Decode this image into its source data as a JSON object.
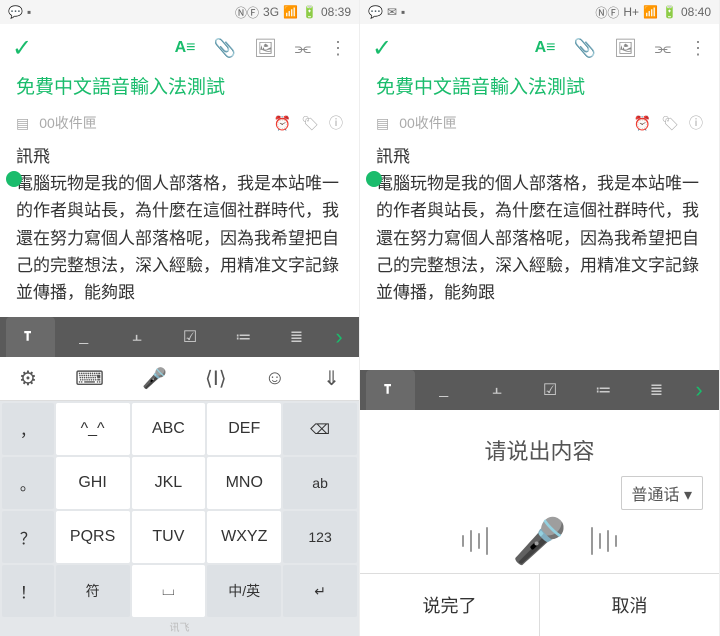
{
  "left": {
    "status": {
      "time": "08:39",
      "net": "3G"
    },
    "title": "免費中文語音輸入法測試",
    "inbox": "00收件匣",
    "author": "訊飛",
    "body": "電腦玩物是我的個人部落格，我是本站唯一的作者與站長，為什麼在這個社群時代，我還在努力寫個人部落格呢，因為我希望把自己的完整想法，深入經驗，用精准文字記錄並傳播，能夠跟",
    "keys": {
      "r1": [
        "，",
        "^_^",
        "ABC",
        "DEF",
        "⌫"
      ],
      "r2": [
        "。",
        "GHI",
        "JKL",
        "MNO",
        "ab"
      ],
      "r3": [
        "？",
        "PQRS",
        "TUV",
        "WXYZ",
        "123"
      ],
      "r4": [
        "！",
        "符",
        "⌴",
        "中/英",
        "↵"
      ]
    },
    "brand": "讯飞"
  },
  "right": {
    "status": {
      "time": "08:40",
      "net": "H+"
    },
    "title": "免費中文語音輸入法測試",
    "inbox": "00收件匣",
    "author": "訊飛",
    "body": "電腦玩物是我的個人部落格，我是本站唯一的作者與站長，為什麼在這個社群時代，我還在努力寫個人部落格呢，因為我希望把自己的完整想法，深入經驗，用精准文字記錄並傳播，能夠跟",
    "voice": {
      "prompt": "请说出内容",
      "lang": "普通话",
      "done": "说完了",
      "cancel": "取消"
    }
  },
  "tabs": [
    "A",
    "⌐",
    "⌐⌐",
    "☑",
    "≡",
    "≣"
  ]
}
